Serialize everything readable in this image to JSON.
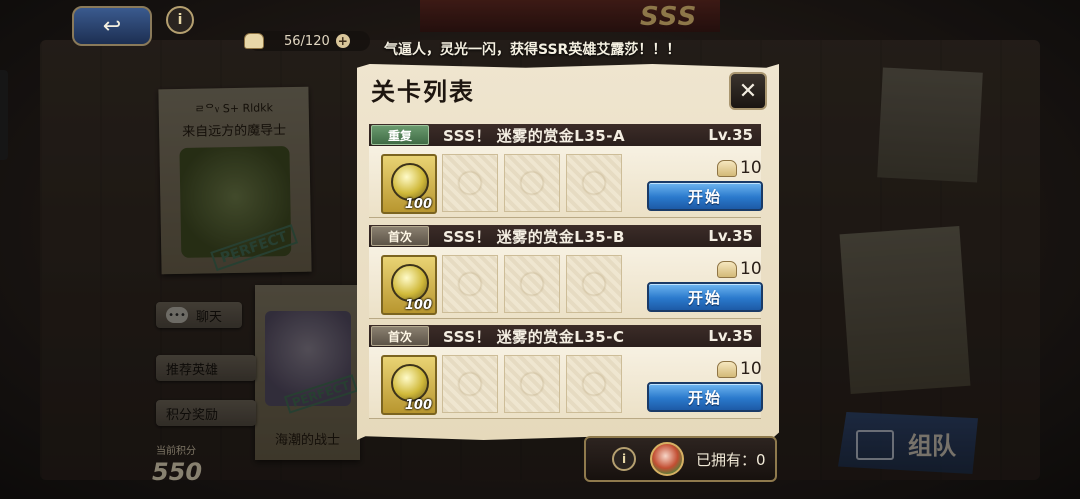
{
  "header": {
    "back_icon": "↩",
    "info_icon": "i",
    "logo_text": "SSS",
    "stamina": "56/120",
    "stamina_plus": "+"
  },
  "ticker": "气逼人，灵光一闪，获得SSR英雄艾露莎！！！",
  "background": {
    "poster1_header": "ㄹᄋ᥎ S+ Rldkk",
    "poster1_name": "来自远方的魔导士",
    "poster1_stamp": "PERFECT",
    "poster2_name": "海潮的战士",
    "poster2_stamp": "PERFECT",
    "buttons": {
      "chat": "聊天",
      "chat_icon": "•••",
      "recommend": "推荐英雄",
      "points_reward": "积分奖励"
    },
    "score_label": "当前积分",
    "score_value": "550",
    "team_button": "组队"
  },
  "modal": {
    "title": "关卡列表",
    "close_icon": "✕",
    "stages": [
      {
        "badge": "重复",
        "badge_type": "repeat",
        "name": "SSS！ 迷雾的赏金L35-A",
        "level": "Lv.35",
        "reward_qty": "100",
        "cost": "10",
        "start_label": "开始"
      },
      {
        "badge": "首次",
        "badge_type": "first",
        "name": "SSS！ 迷雾的赏金L35-B",
        "level": "Lv.35",
        "reward_qty": "100",
        "cost": "10",
        "start_label": "开始"
      },
      {
        "badge": "首次",
        "badge_type": "first",
        "name": "SSS！ 迷雾的赏金L35-C",
        "level": "Lv.35",
        "reward_qty": "100",
        "cost": "10",
        "start_label": "开始"
      }
    ]
  },
  "owned_bar": {
    "info_icon": "i",
    "text": "已拥有：0"
  },
  "colors": {
    "start_button": "#2a79cc",
    "repeat_badge": "#3f6b45",
    "first_badge": "#5c5347",
    "header_bar": "#2a1f1c"
  }
}
